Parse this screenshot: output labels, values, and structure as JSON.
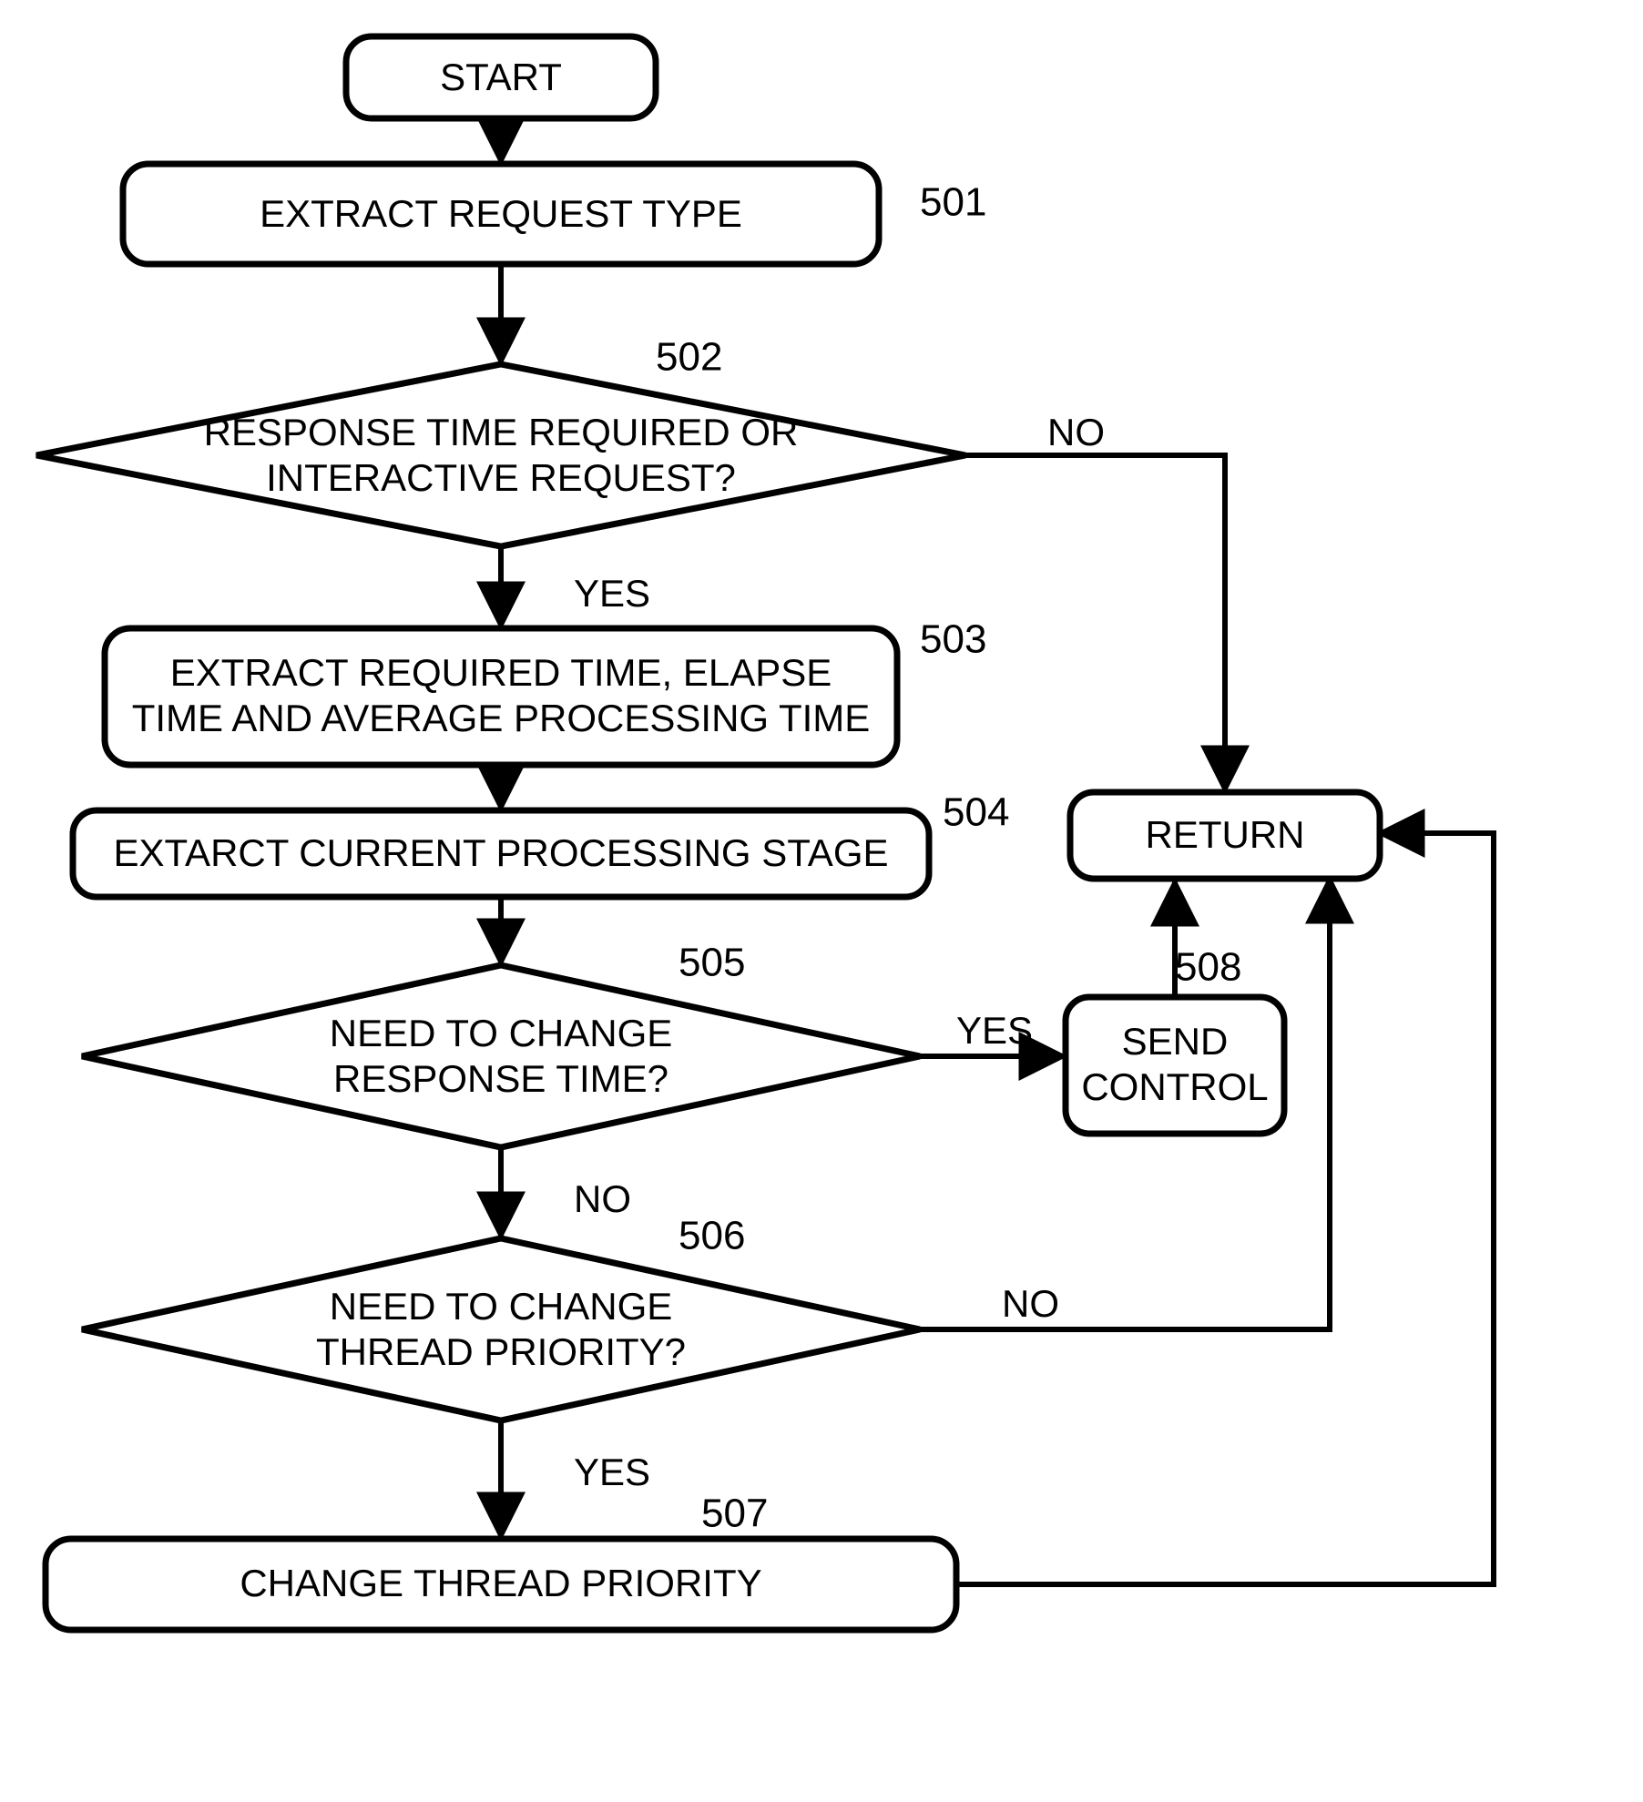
{
  "nodes": {
    "start": {
      "text": "START",
      "label": ""
    },
    "n501": {
      "text": "EXTRACT  REQUEST TYPE",
      "label": "501"
    },
    "n502": {
      "line1": "RESPONSE TIME REQUIRED OR",
      "line2": "INTERACTIVE REQUEST?",
      "label": "502"
    },
    "n503": {
      "line1": "EXTRACT REQUIRED TIME, ELAPSE",
      "line2": "TIME AND AVERAGE PROCESSING TIME",
      "label": "503"
    },
    "n504": {
      "text": "EXTARCT CURRENT PROCESSING STAGE",
      "label": "504"
    },
    "n505": {
      "line1": "NEED TO CHANGE",
      "line2": "RESPONSE TIME?",
      "label": "505"
    },
    "n506": {
      "line1": "NEED TO CHANGE",
      "line2": "THREAD PRIORITY?",
      "label": "506"
    },
    "n507": {
      "text": "CHANGE THREAD PRIORITY",
      "label": "507"
    },
    "n508": {
      "line1": "SEND",
      "line2": "CONTROL",
      "label": "508"
    },
    "return": {
      "text": "RETURN",
      "label": ""
    }
  },
  "edges": {
    "e502no": "NO",
    "e502yes": "YES",
    "e505yes": "YES",
    "e505no": "NO",
    "e506no": "NO",
    "e506yes": "YES"
  }
}
